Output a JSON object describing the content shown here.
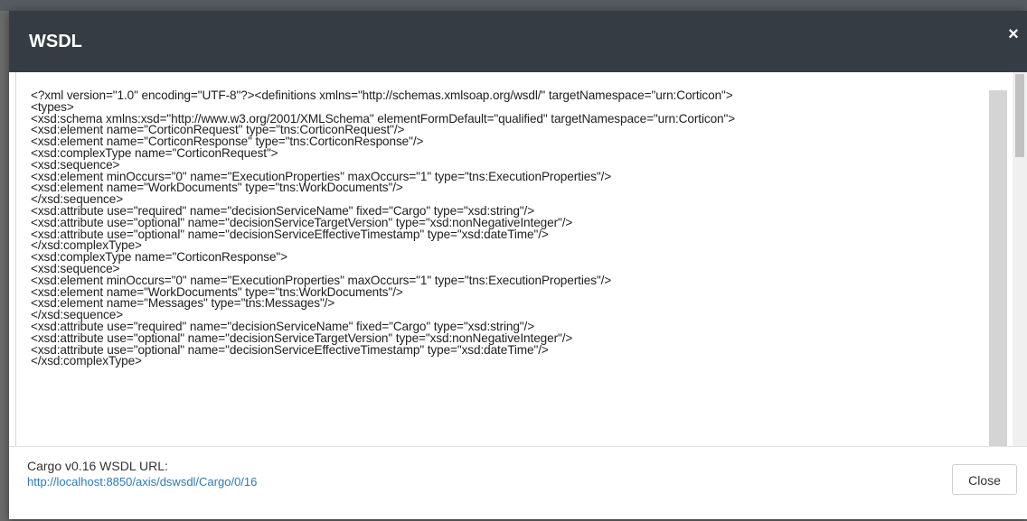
{
  "modal": {
    "title": "WSDL",
    "close_icon": "×"
  },
  "wsdl": {
    "lines": [
      "<?xml version=\"1.0\" encoding=\"UTF-8\"?><definitions xmlns=\"http://schemas.xmlsoap.org/wsdl/\" targetNamespace=\"urn:Corticon\">",
      "<types>",
      "<xsd:schema xmlns:xsd=\"http://www.w3.org/2001/XMLSchema\" elementFormDefault=\"qualified\" targetNamespace=\"urn:Corticon\">",
      "<xsd:element name=\"CorticonRequest\" type=\"tns:CorticonRequest\"/>",
      "<xsd:element name=\"CorticonResponse\" type=\"tns:CorticonResponse\"/>",
      "<xsd:complexType name=\"CorticonRequest\">",
      "<xsd:sequence>",
      "<xsd:element minOccurs=\"0\" name=\"ExecutionProperties\" maxOccurs=\"1\" type=\"tns:ExecutionProperties\"/>",
      "<xsd:element name=\"WorkDocuments\" type=\"tns:WorkDocuments\"/>",
      "</xsd:sequence>",
      "<xsd:attribute use=\"required\" name=\"decisionServiceName\" fixed=\"Cargo\" type=\"xsd:string\"/>",
      "<xsd:attribute use=\"optional\" name=\"decisionServiceTargetVersion\" type=\"xsd:nonNegativeInteger\"/>",
      "<xsd:attribute use=\"optional\" name=\"decisionServiceEffectiveTimestamp\" type=\"xsd:dateTime\"/>",
      "</xsd:complexType>",
      "<xsd:complexType name=\"CorticonResponse\">",
      "<xsd:sequence>",
      "<xsd:element minOccurs=\"0\" name=\"ExecutionProperties\" maxOccurs=\"1\" type=\"tns:ExecutionProperties\"/>",
      "<xsd:element name=\"WorkDocuments\" type=\"tns:WorkDocuments\"/>",
      "<xsd:element name=\"Messages\" type=\"tns:Messages\"/>",
      "</xsd:sequence>",
      "<xsd:attribute use=\"required\" name=\"decisionServiceName\" fixed=\"Cargo\" type=\"xsd:string\"/>",
      "<xsd:attribute use=\"optional\" name=\"decisionServiceTargetVersion\" type=\"xsd:nonNegativeInteger\"/>",
      "<xsd:attribute use=\"optional\" name=\"decisionServiceEffectiveTimestamp\" type=\"xsd:dateTime\"/>",
      "</xsd:complexType>"
    ]
  },
  "footer": {
    "url_label": "Cargo v0.16 WSDL URL:",
    "url": "http://localhost:8850/axis/dswsdl/Cargo/0/16",
    "close_label": "Close"
  },
  "colors": {
    "header_bg": "#353c43",
    "link": "#2a7ab8"
  }
}
